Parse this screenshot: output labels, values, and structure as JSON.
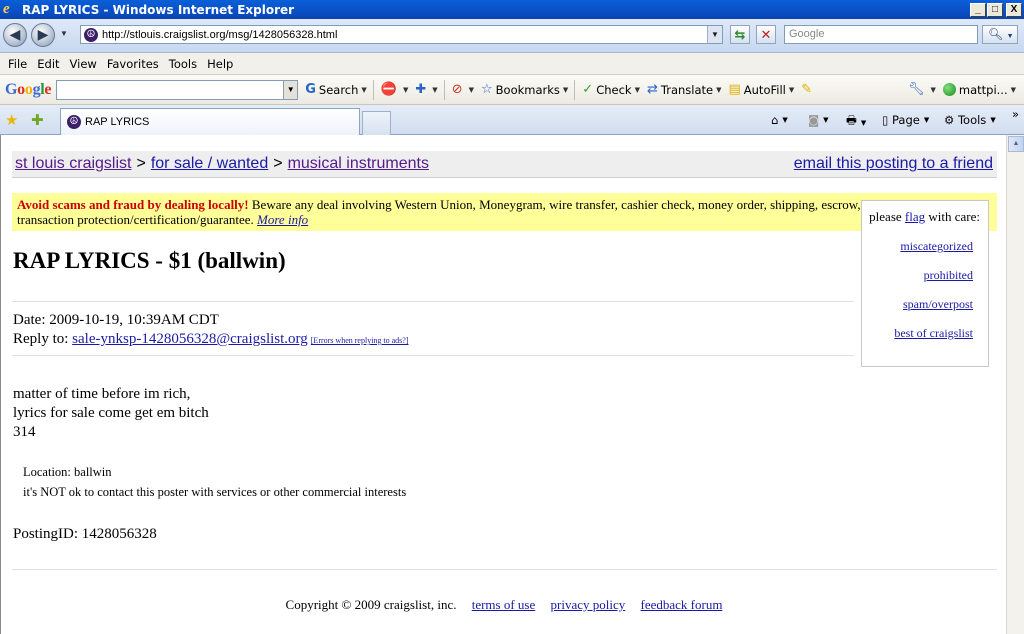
{
  "window": {
    "title": "RAP LYRICS - Windows Internet Explorer",
    "min": "_",
    "max": "□",
    "close": "X"
  },
  "address": {
    "url": "http://stlouis.craigslist.org/msg/1428056328.html",
    "search_placeholder": "Google"
  },
  "menu": [
    "File",
    "Edit",
    "View",
    "Favorites",
    "Tools",
    "Help"
  ],
  "google_toolbar": {
    "logo": [
      "G",
      "o",
      "o",
      "g",
      "l",
      "e"
    ],
    "search_label": "Search",
    "bookmarks_label": "Bookmarks",
    "check_label": "Check",
    "translate_label": "Translate",
    "autofill_label": "AutoFill",
    "account_label": "mattpi..."
  },
  "tabs": {
    "active_tab": "RAP LYRICS",
    "page_label": "Page",
    "tools_label": "Tools"
  },
  "page": {
    "breadcrumb": {
      "site": "st louis craigslist",
      "section": "for sale / wanted",
      "category": "musical instruments",
      "separator": ">",
      "email_link": "email this posting to a friend"
    },
    "scam_warning": {
      "strong": "Avoid scams and fraud by dealing locally!",
      "text": " Beware any deal involving Western Union, Moneygram, wire transfer, cashier check, money order, shipping, escrow, or any promise of transaction protection/certification/guarantee.",
      "more": "More info"
    },
    "flag": {
      "prefix": "please ",
      "flag_word": "flag",
      "suffix": " with care:",
      "links": [
        "miscategorized",
        "prohibited",
        "spam/overpost",
        "best of craigslist"
      ]
    },
    "title": "RAP LYRICS - $1 (ballwin)",
    "date_line": "Date: 2009-10-19, 10:39AM CDT",
    "reply_label": "Reply to: ",
    "reply_email": "sale-ynksp-1428056328@craigslist.org",
    "reply_errors": "[Errors when replying to ads?]",
    "body": {
      "line1": "matter of time before im rich,",
      "line2": "lyrics for sale come get em bitch",
      "line3": "314"
    },
    "details": {
      "location": "Location: ballwin",
      "contact": "it's NOT ok to contact this poster with services or other commercial interests"
    },
    "posting_id": "PostingID: 1428056328",
    "footer": {
      "copyright": "Copyright © 2009 craigslist, inc.",
      "terms": "terms of use",
      "privacy": "privacy policy",
      "feedback": "feedback forum"
    }
  }
}
